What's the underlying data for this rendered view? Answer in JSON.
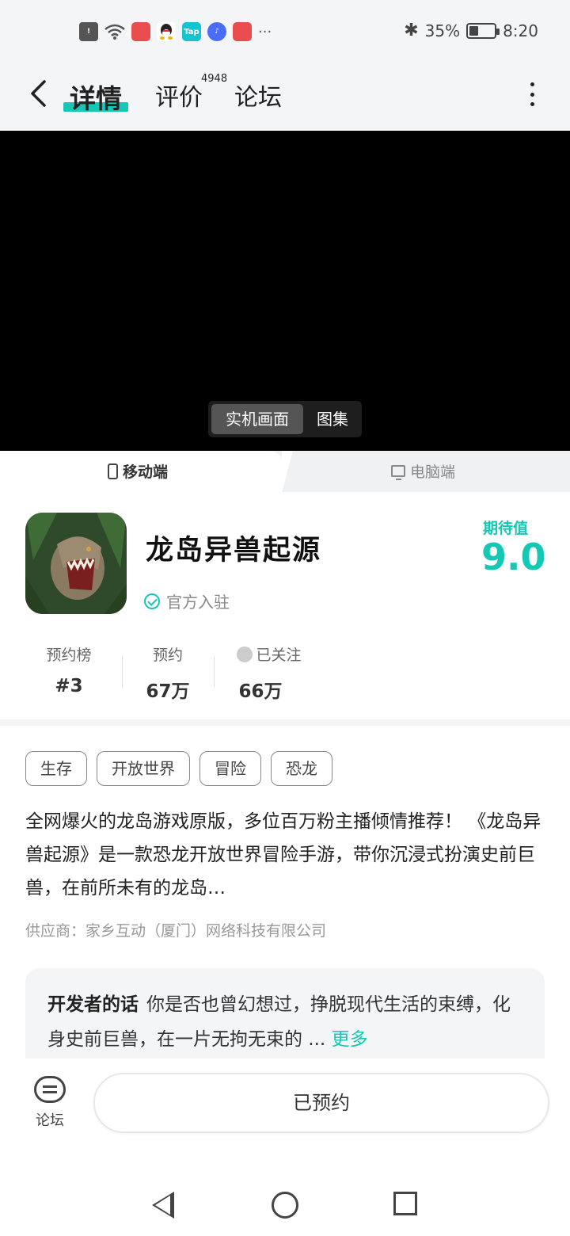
{
  "status_bar": {
    "battery_percent": "35%",
    "battery_level": 0.35,
    "time": "8:20",
    "apps": [
      {
        "name": "alert-icon",
        "color": "#555555"
      },
      {
        "name": "wifi-icon",
        "color": "#555555"
      },
      {
        "name": "huawei-appgallery-icon",
        "color": "#e84c4c"
      },
      {
        "name": "qq-icon",
        "color": "#222222"
      },
      {
        "name": "taptap-icon",
        "color": "#15c5ce"
      },
      {
        "name": "music-icon",
        "color": "#4a6cf7"
      },
      {
        "name": "huawei-appgallery-icon-2",
        "color": "#e84c4c"
      }
    ],
    "more": "···"
  },
  "header": {
    "tabs": [
      {
        "label": "详情"
      },
      {
        "label": "评价"
      },
      {
        "label": "论坛"
      }
    ],
    "review_count": "4948"
  },
  "media": {
    "options": [
      "实机画面",
      "图集"
    ]
  },
  "platform": {
    "mobile": "移动端",
    "pc": "电脑端"
  },
  "game": {
    "title": "龙岛异兽起源",
    "official": "官方入驻",
    "expect_label": "期待值",
    "expect_value": "9.0"
  },
  "stats": [
    {
      "label": "预约榜",
      "value": "#3"
    },
    {
      "label": "预约",
      "value": "67万"
    },
    {
      "label": "已关注",
      "value": "66万"
    }
  ],
  "tags": [
    "生存",
    "开放世界",
    "冒险",
    "恐龙"
  ],
  "description": "全网爆火的龙岛游戏原版，多位百万粉主播倾情推荐！ 《龙岛异兽起源》是一款恐龙开放世界冒险手游，带你沉浸式扮演史前巨兽，在前所未有的龙岛…",
  "supplier": "供应商：家乡互动（厦门）网络科技有限公司",
  "developer": {
    "label": "开发者的话",
    "text": "你是否也曾幻想过，挣脱现代生活的束缚，化身史前巨兽，在一片无拘无束的 ...",
    "more": "更多"
  },
  "action_bar": {
    "forum_label": "论坛",
    "reserve_label": "已预约"
  },
  "colors": {
    "accent": "#14c8b4",
    "page_bg": "#f4f5f7"
  }
}
